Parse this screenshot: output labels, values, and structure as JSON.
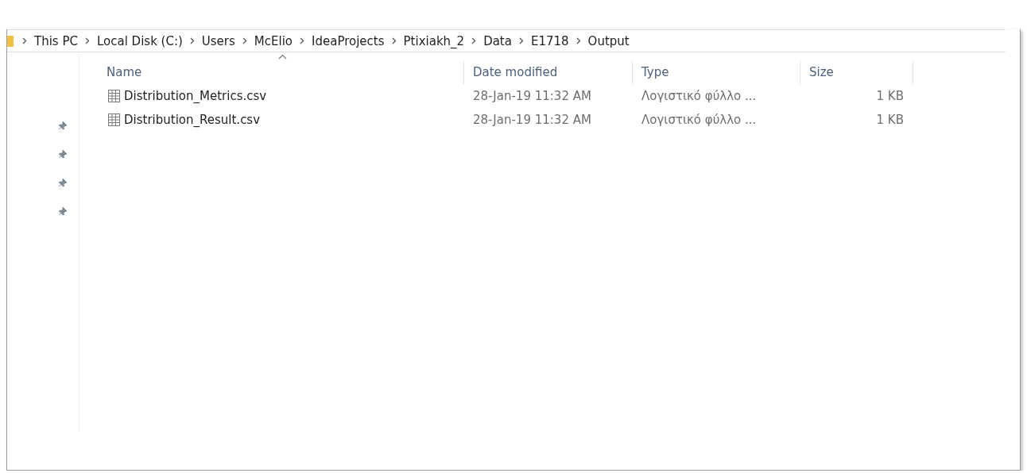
{
  "address_bar": {
    "breadcrumbs": [
      "This PC",
      "Local Disk (C:)",
      "Users",
      "McElio",
      "IdeaProjects",
      "Ptixiakh_2",
      "Data",
      "E1718",
      "Output"
    ]
  },
  "file_list": {
    "columns": [
      "Name",
      "Date modified",
      "Type",
      "Size"
    ],
    "rows": [
      {
        "name": "Distribution_Metrics.csv",
        "date_modified": "28-Jan-19 11:32 AM",
        "type": "Λογιστικό φύλλο ...",
        "size": "1 KB"
      },
      {
        "name": "Distribution_Result.csv",
        "date_modified": "28-Jan-19 11:32 AM",
        "type": "Λογιστικό φύλλο ...",
        "size": "1 KB"
      }
    ]
  }
}
